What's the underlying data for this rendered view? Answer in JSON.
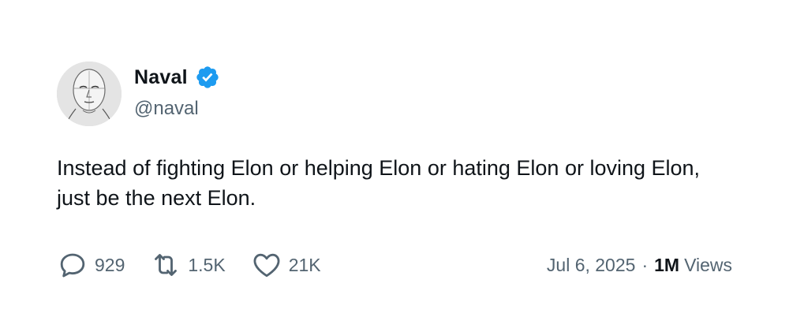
{
  "author": {
    "display_name": "Naval",
    "handle": "@naval",
    "verified": true
  },
  "tweet": {
    "text": "Instead of fighting Elon or helping Elon or hating Elon or loving Elon, just be the next Elon."
  },
  "stats": {
    "replies": "929",
    "retweets": "1.5K",
    "likes": "21K"
  },
  "meta": {
    "date": "Jul 6, 2025",
    "separator": "·",
    "views_count": "1M",
    "views_label": "Views"
  },
  "icons": {
    "reply": "reply-icon",
    "retweet": "retweet-icon",
    "like": "heart-icon",
    "verified": "verified-badge-icon"
  },
  "colors": {
    "verified_blue": "#1d9bf0",
    "secondary_text": "#536471",
    "primary_text": "#0f1419"
  }
}
